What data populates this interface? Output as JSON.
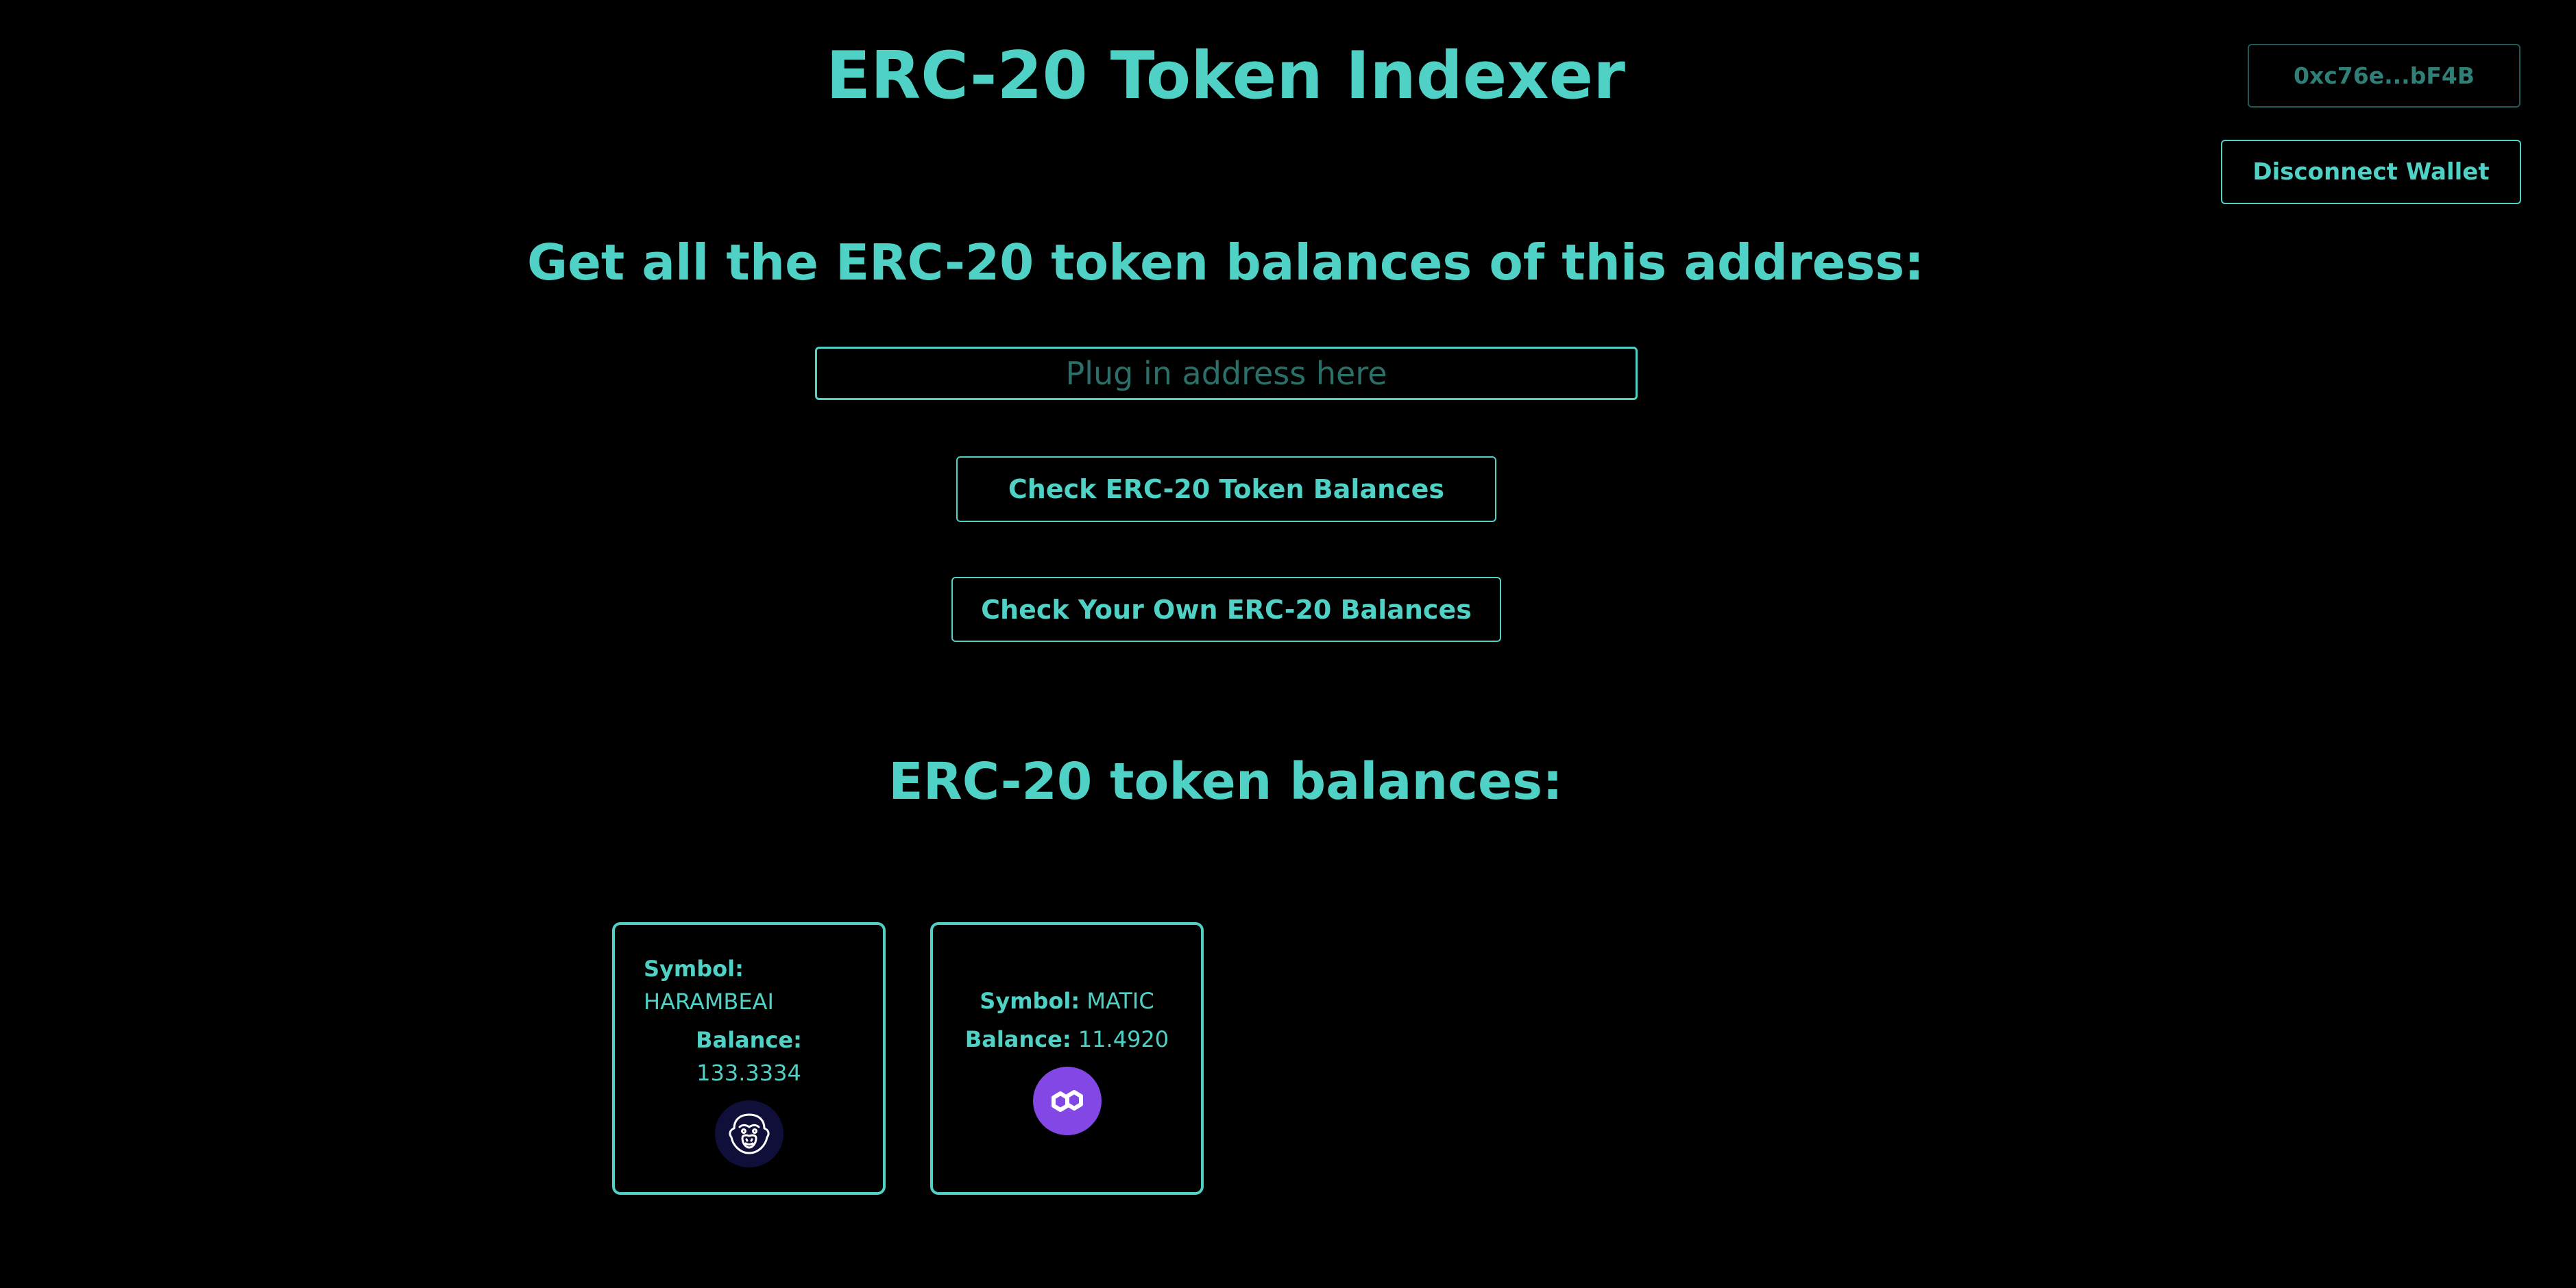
{
  "header": {
    "title": "ERC-20 Token Indexer",
    "wallet_address": "0xc76e...bF4B",
    "disconnect_label": "Disconnect Wallet"
  },
  "query": {
    "heading": "Get all the ERC-20 token balances of this address:",
    "input_value": "",
    "input_placeholder": "Plug in address here",
    "check_button_label": "Check ERC-20 Token Balances",
    "check_own_button_label": "Check Your Own ERC-20 Balances"
  },
  "results": {
    "heading": "ERC-20 token balances:",
    "symbol_label": "Symbol:",
    "balance_label": "Balance:",
    "tokens": [
      {
        "symbol": "HARAMBEAI",
        "balance": "133.3334",
        "icon": "gorilla-icon"
      },
      {
        "symbol": "MATIC",
        "balance": "11.4920",
        "icon": "polygon-icon"
      }
    ]
  },
  "colors": {
    "accent": "#4fd1c5",
    "background": "#000000",
    "matic_brand": "#8247e5"
  }
}
